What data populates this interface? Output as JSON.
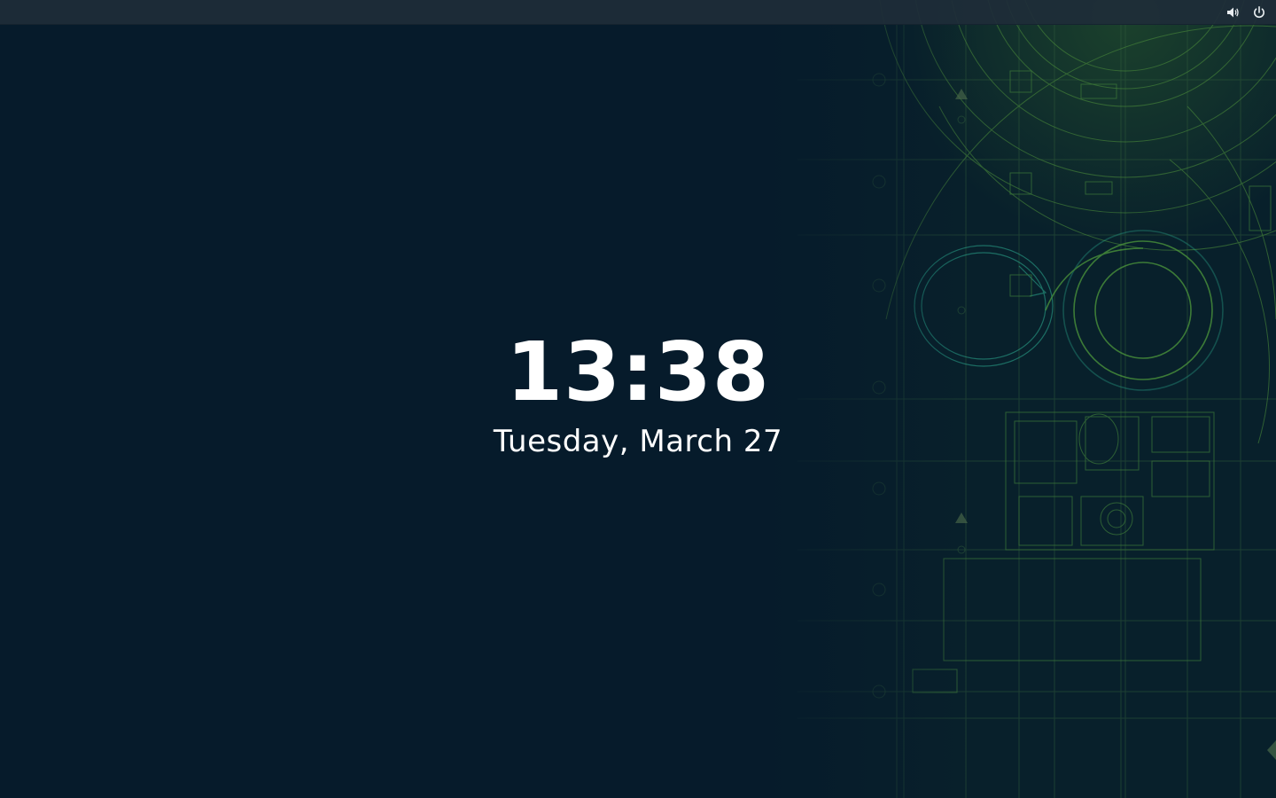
{
  "lock_screen": {
    "time": "13:38",
    "date": "Tuesday, March 27"
  },
  "top_bar": {
    "icons": [
      "volume-icon",
      "power-icon"
    ]
  },
  "colors": {
    "background": "#061b2b",
    "top_bar": "#1e2c38",
    "text": "#ffffff",
    "blueprint_green": "#3f8f45",
    "blueprint_teal": "#2aa38a"
  }
}
